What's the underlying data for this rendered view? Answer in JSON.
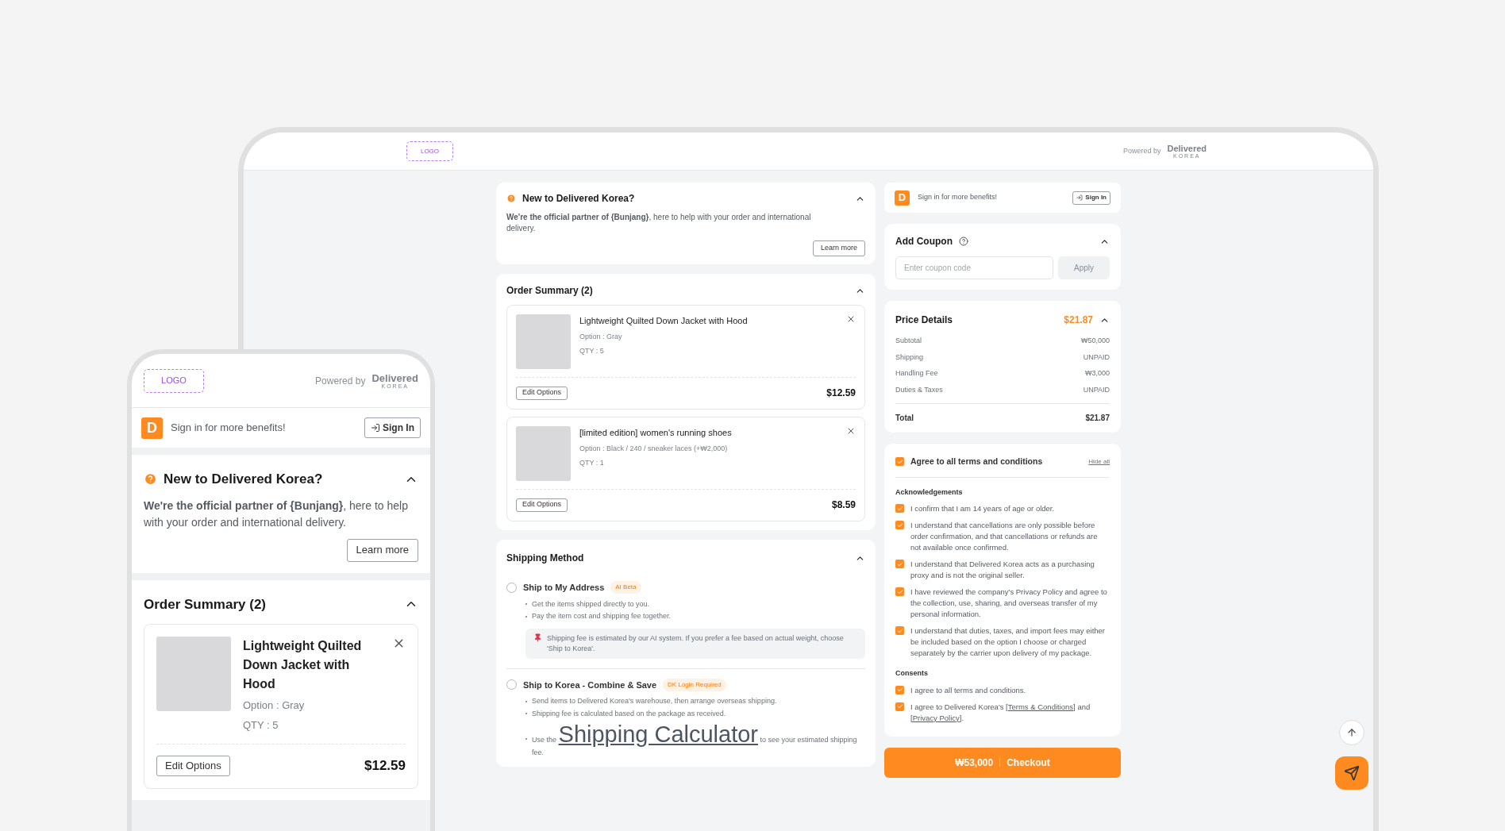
{
  "tablet": {
    "header": {
      "logo": "LOGO",
      "powered_by": "Powered by",
      "brand": "Delivered",
      "brand_sub": "KOREA"
    },
    "intro": {
      "title": "New to Delivered Korea?",
      "expanded": true,
      "text": "**We're the official partner of {Bunjang}**, here to help with your order and international delivery.",
      "button": "Learn more"
    },
    "order_summary": {
      "title": "Order Summary (2)",
      "expanded": true,
      "items": [
        {
          "name": "Lightweight Quilted Down Jacket with Hood",
          "option": "Option : Gray",
          "qty": "QTY : 5",
          "edit": "Edit Options",
          "price": "$12.59"
        },
        {
          "name": "[limited edition] women's running shoes",
          "option": "Option : Black / 240 / sneaker laces (+₩2,000)",
          "qty": "QTY : 1",
          "edit": "Edit Options",
          "price": "$8.59"
        }
      ]
    },
    "shipping": {
      "title": "Shipping Method",
      "expanded": true,
      "options": [
        {
          "label": "Ship to My Address",
          "badge": "AI Beta",
          "selected": false,
          "bullets": [
            {
              "text": "Get the items shipped directly to you."
            },
            {
              "text": "Pay the item cost and shipping fee together."
            }
          ],
          "note": "Shipping fee is estimated by our AI system. If you prefer a fee based on actual weight, choose 'Ship to Korea'."
        },
        {
          "label": "Ship to Korea - Combine & Save",
          "badge": "DK Login Required",
          "selected": false,
          "bullets": [
            {
              "text": "Send items to Delivered Korea's warehouse, then arrange overseas shipping."
            },
            {
              "text": "Shipping fee is calculated based on the package as received."
            },
            {
              "text": "Use the",
              "link": "Shipping Calculator",
              "after": "to see your estimated shipping fee."
            }
          ]
        }
      ]
    },
    "signin": {
      "badge": "D",
      "text": "Sign in for more benefits!",
      "button": "Sign In"
    },
    "coupon": {
      "title": "Add Coupon",
      "expanded": true,
      "placeholder": "Enter coupon code",
      "button": "Apply"
    },
    "price_details": {
      "title": "Price Details",
      "amount": "$21.87",
      "expanded": true,
      "rows": [
        {
          "label": "Subtotal",
          "value": "₩50,000"
        },
        {
          "label": "Shipping",
          "value": "UNPAID"
        },
        {
          "label": "Handling Fee",
          "value": "₩3,000"
        },
        {
          "label": "Duties & Taxes",
          "value": "UNPAID"
        }
      ],
      "total_label": "Total",
      "total_value": "$21.87"
    },
    "terms": {
      "all_label": "Agree to all terms and conditions",
      "all_checked": true,
      "hide": "Hide all",
      "groups": [
        {
          "title": "Acknowledgements",
          "items": [
            {
              "parts": [
                {
                  "text": "I confirm that I am 14 years of age or older."
                }
              ],
              "checked": true
            },
            {
              "parts": [
                {
                  "text": "I understand that cancellations are only possible before order confirmation, and that cancellations or refunds are not available once confirmed."
                }
              ],
              "checked": true
            },
            {
              "parts": [
                {
                  "text": "I understand that Delivered Korea acts as a purchasing proxy and is not the original seller."
                }
              ],
              "checked": true
            },
            {
              "parts": [
                {
                  "text": "I have reviewed the company's Privacy Policy and agree to the collection, use, sharing, and overseas transfer of my personal information."
                }
              ],
              "checked": true
            },
            {
              "parts": [
                {
                  "text": "I understand that duties, taxes, and import fees may either be included based on the option I choose or charged separately by the carrier upon delivery of my package."
                }
              ],
              "checked": true
            }
          ]
        },
        {
          "title": "Consents",
          "items": [
            {
              "parts": [
                {
                  "text": "I agree to all terms and conditions."
                }
              ],
              "checked": true
            },
            {
              "parts": [
                {
                  "text": "I agree to Delivered Korea's "
                },
                {
                  "text": "[Terms & Conditions]",
                  "link": true
                },
                {
                  "text": " and "
                },
                {
                  "text": "[Privacy Policy]",
                  "link": true
                },
                {
                  "text": "."
                }
              ],
              "checked": true
            }
          ]
        }
      ]
    },
    "checkout": {
      "amount": "₩53,000",
      "label": "Checkout"
    }
  },
  "phone": {
    "header": {
      "logo": "LOGO",
      "powered_by": "Powered by",
      "brand": "Delivered",
      "brand_sub": "KOREA"
    },
    "signin": {
      "badge": "D",
      "text": "Sign in for more benefits!",
      "button": "Sign In"
    },
    "intro": {
      "title": "New to Delivered Korea?",
      "expanded": true,
      "text": "**We're the official partner of {Bunjang}**, here to help with your order and international delivery.",
      "button": "Learn more"
    },
    "order_summary": {
      "title": "Order Summary (2)",
      "expanded": true,
      "items": [
        {
          "name": "Lightweight Quilted Down Jacket with Hood",
          "option": "Option : Gray",
          "qty": "QTY : 5",
          "edit": "Edit Options",
          "price": "$12.59"
        }
      ]
    }
  }
}
